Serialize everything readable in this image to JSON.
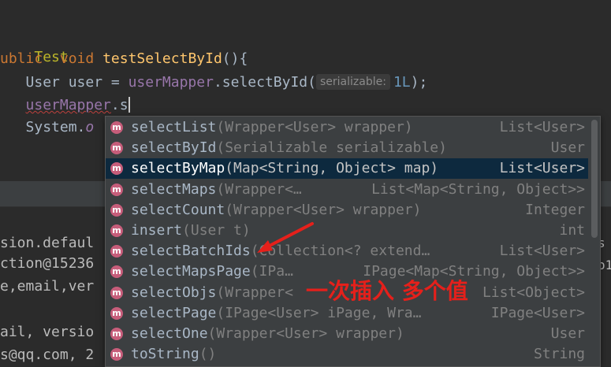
{
  "editor": {
    "annotation": "Test",
    "sig_public": "ublic",
    "sig_void": "void",
    "sig_method": "testSelectById",
    "sig_paren": "(){",
    "stmt_type": "User user = ",
    "stmt_field": "userMapper",
    "stmt_call": ".selectById(",
    "stmt_hint": "serializable:",
    "stmt_arg": "1L",
    "stmt_end": ");",
    "typing_field": "userMapper",
    "typing_text": ".s",
    "system_prefix": "System.",
    "system_suffix": "o"
  },
  "console": {
    "lines": [
      "sion.defaul",
      "ction@15236",
      "e,email,ver",
      "",
      "ail, versio",
      "s@qq.com, 2"
    ],
    "right_fragments": [
      "s",
      "o1"
    ]
  },
  "completion": {
    "badge": "m",
    "items": [
      {
        "name": "selectList",
        "params": "(Wrapper<User> wrapper)",
        "ret": "List<User>",
        "selected": false
      },
      {
        "name": "selectById",
        "params": "(Serializable serializable)",
        "ret": "User",
        "selected": false
      },
      {
        "name": "selectByMap",
        "params": "(Map<String, Object> map)",
        "ret": "List<User>",
        "selected": true
      },
      {
        "name": "selectMaps",
        "params": "(Wrapper<…",
        "ret": "List<Map<String, Object>>",
        "selected": false
      },
      {
        "name": "selectCount",
        "params": "(Wrapper<User> wrapper)",
        "ret": "Integer",
        "selected": false
      },
      {
        "name": "insert",
        "params": "(User t)",
        "ret": "int",
        "selected": false
      },
      {
        "name": "selectBatchIds",
        "params": "(Collection<? extend…",
        "ret": "List<User>",
        "selected": false
      },
      {
        "name": "selectMapsPage",
        "params": "(IPa…",
        "ret": "IPage<Map<String, Object>>",
        "selected": false
      },
      {
        "name": "selectObjs",
        "params": "(Wrapper<",
        "ret": "List<Object>",
        "selected": false
      },
      {
        "name": "selectPage",
        "params": "(IPage<User> iPage, Wra…",
        "ret": "IPage<User>",
        "selected": false
      },
      {
        "name": "selectOne",
        "params": "(Wrapper<User> wrapper)",
        "ret": "User",
        "selected": false
      },
      {
        "name": "toString",
        "params": "()",
        "ret": "String",
        "selected": false
      }
    ]
  },
  "annotation_text": "一次插入 多个值",
  "colors": {
    "annotation_red": "#e5201b",
    "selection": "#0d293e",
    "method_badge": "#c65d7a"
  }
}
